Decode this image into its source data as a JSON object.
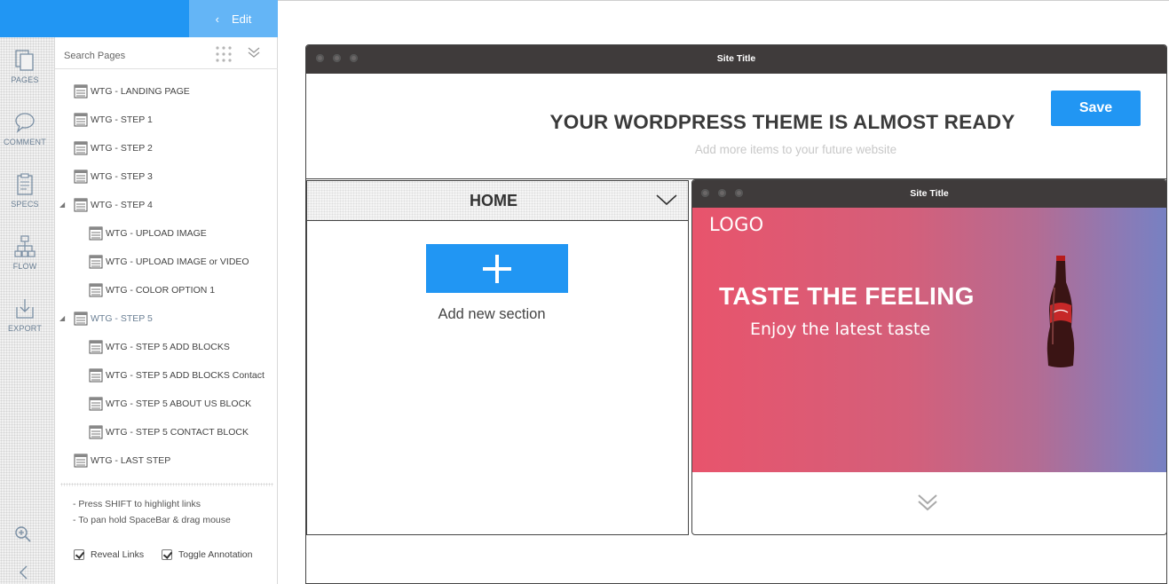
{
  "header": {
    "edit_label": "Edit"
  },
  "rail": {
    "items": [
      {
        "label": "PAGES",
        "icon": "pages-icon"
      },
      {
        "label": "COMMENT",
        "icon": "comment-icon"
      },
      {
        "label": "SPECS",
        "icon": "specs-icon"
      },
      {
        "label": "FLOW",
        "icon": "flow-icon"
      },
      {
        "label": "EXPORT",
        "icon": "export-icon"
      }
    ]
  },
  "pages_panel": {
    "search_placeholder": "Search Pages",
    "pages": [
      {
        "label": "WTG - LANDING PAGE"
      },
      {
        "label": "WTG - STEP 1"
      },
      {
        "label": "WTG - STEP 2"
      },
      {
        "label": "WTG - STEP 3"
      },
      {
        "label": "WTG - STEP 4"
      },
      {
        "label": "WTG - UPLOAD IMAGE"
      },
      {
        "label": "WTG - UPLOAD IMAGE or VIDEO"
      },
      {
        "label": "WTG - COLOR OPTION 1"
      },
      {
        "label": "WTG - STEP 5"
      },
      {
        "label": "WTG - STEP 5 ADD BLOCKS"
      },
      {
        "label": "WTG - STEP 5 ADD BLOCKS Contact"
      },
      {
        "label": "WTG - STEP 5 ABOUT US BLOCK"
      },
      {
        "label": "WTG - STEP 5 CONTACT BLOCK"
      },
      {
        "label": "WTG - LAST STEP"
      }
    ],
    "tips": [
      "- Press SHIFT to highlight links",
      "- To pan hold SpaceBar & drag mouse"
    ],
    "reveal_links_label": "Reveal Links",
    "toggle_annotation_label": "Toggle Annotation"
  },
  "canvas": {
    "window_title": "Site Title",
    "save_label": "Save",
    "headline": "YOUR WORDPRESS THEME IS ALMOST READY",
    "subheadline": "Add more items to your future website",
    "home": {
      "label": "HOME",
      "add_section_label": "Add new section"
    },
    "preview": {
      "window_title": "Site Title",
      "logo_text": "LOGO",
      "hero_title": "TASTE THE FEELING",
      "hero_subtitle": "Enjoy the latest taste"
    }
  },
  "colors": {
    "accent": "#2196f3",
    "titlebar": "#3f3b3b"
  }
}
